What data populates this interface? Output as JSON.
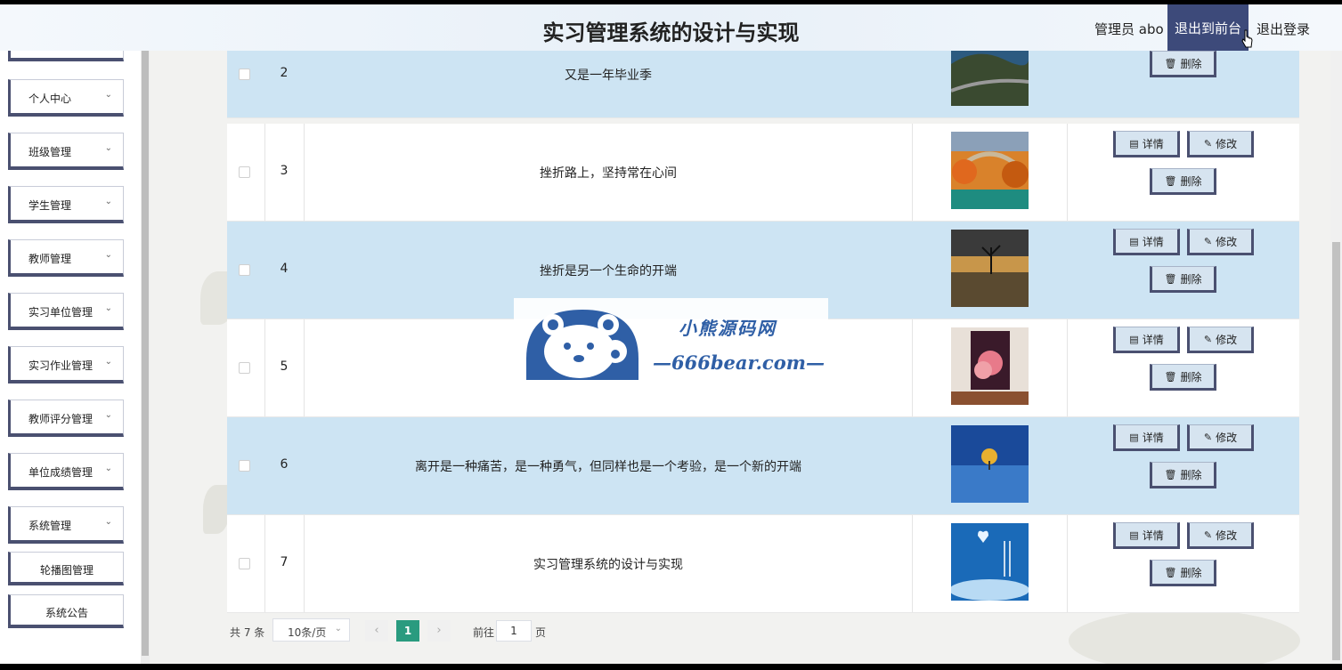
{
  "header": {
    "title": "实习管理系统的设计与实现",
    "admin_label": "管理员 abo",
    "front_button": "退出到前台",
    "logout_button": "退出登录"
  },
  "sidebar": {
    "items": [
      {
        "label": "个人中心"
      },
      {
        "label": "班级管理"
      },
      {
        "label": "学生管理"
      },
      {
        "label": "教师管理"
      },
      {
        "label": "实习单位管理"
      },
      {
        "label": "实习作业管理"
      },
      {
        "label": "教师评分管理"
      },
      {
        "label": "单位成绩管理"
      },
      {
        "label": "系统管理"
      }
    ],
    "sub_items": [
      {
        "label": "轮播图管理"
      },
      {
        "label": "系统公告"
      }
    ]
  },
  "table": {
    "rows": [
      {
        "no": "2",
        "title": "又是一年毕业季",
        "image": "coastal-road-photo"
      },
      {
        "no": "3",
        "title": "挫折路上，坚持常在心间",
        "image": "autumn-bridge-photo"
      },
      {
        "no": "4",
        "title": "挫折是另一个生命的开端",
        "image": "lone-tree-lake-photo"
      },
      {
        "no": "5",
        "title": "",
        "image": "pink-clouds-painting-photo"
      },
      {
        "no": "6",
        "title": "离开是一种痛苦，是一种勇气，但同样也是一个考验，是一个新的开端",
        "image": "tree-lake-blue-photo"
      },
      {
        "no": "7",
        "title": "实习管理系统的设计与实现",
        "image": "heart-cloud-sky-photo"
      }
    ],
    "actions": {
      "detail": "详情",
      "edit": "修改",
      "delete": "删除"
    }
  },
  "pagination": {
    "total": "共 7 条",
    "page_size": "10条/页",
    "current_page": "1",
    "goto_label": "前往",
    "goto_value": "1",
    "page_unit": "页"
  },
  "watermark": {
    "name": "小熊源码网",
    "url": "—666bear.com—"
  }
}
